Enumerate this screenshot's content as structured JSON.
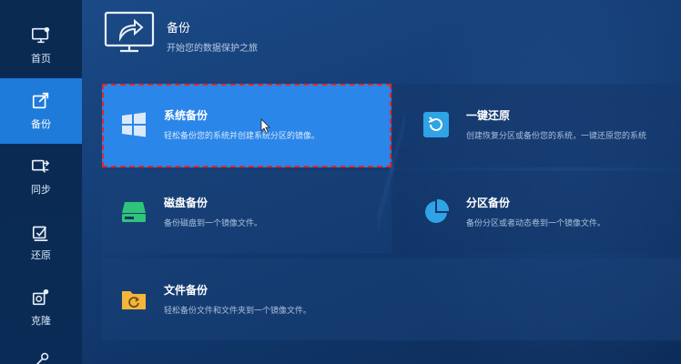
{
  "sidebar": {
    "items": [
      {
        "label": "首页",
        "icon": "monitor-icon"
      },
      {
        "label": "备份",
        "icon": "backup-icon",
        "active": true
      },
      {
        "label": "同步",
        "icon": "sync-icon"
      },
      {
        "label": "还原",
        "icon": "restore-icon"
      },
      {
        "label": "克隆",
        "icon": "clone-icon"
      },
      {
        "label": "",
        "icon": "tools-icon"
      }
    ]
  },
  "header": {
    "title": "备份",
    "subtitle": "开始您的数据保护之旅"
  },
  "cards": {
    "system": {
      "title": "系统备份",
      "desc": "轻松备份您的系统并创建系统分区的镜像。",
      "icon": "windows-icon"
    },
    "restore": {
      "title": "一键还原",
      "desc": "创建恢复分区或备份您的系统，一键还原您的系统",
      "icon": "one-key-restore-icon"
    },
    "disk": {
      "title": "磁盘备份",
      "desc": "备份磁盘到一个镜像文件。",
      "icon": "disk-icon"
    },
    "partition": {
      "title": "分区备份",
      "desc": "备份分区或者动态卷到一个镜像文件。",
      "icon": "pie-chart-icon"
    },
    "file": {
      "title": "文件备份",
      "desc": "轻松备份文件和文件夹到一个镜像文件。",
      "icon": "folder-icon"
    }
  },
  "colors": {
    "accent": "#2a86e8",
    "sidebar_active": "#1e7bd9",
    "selection_outline": "#e0262d",
    "disk_green": "#2fc47a",
    "folder_yellow": "#f3b63a"
  }
}
